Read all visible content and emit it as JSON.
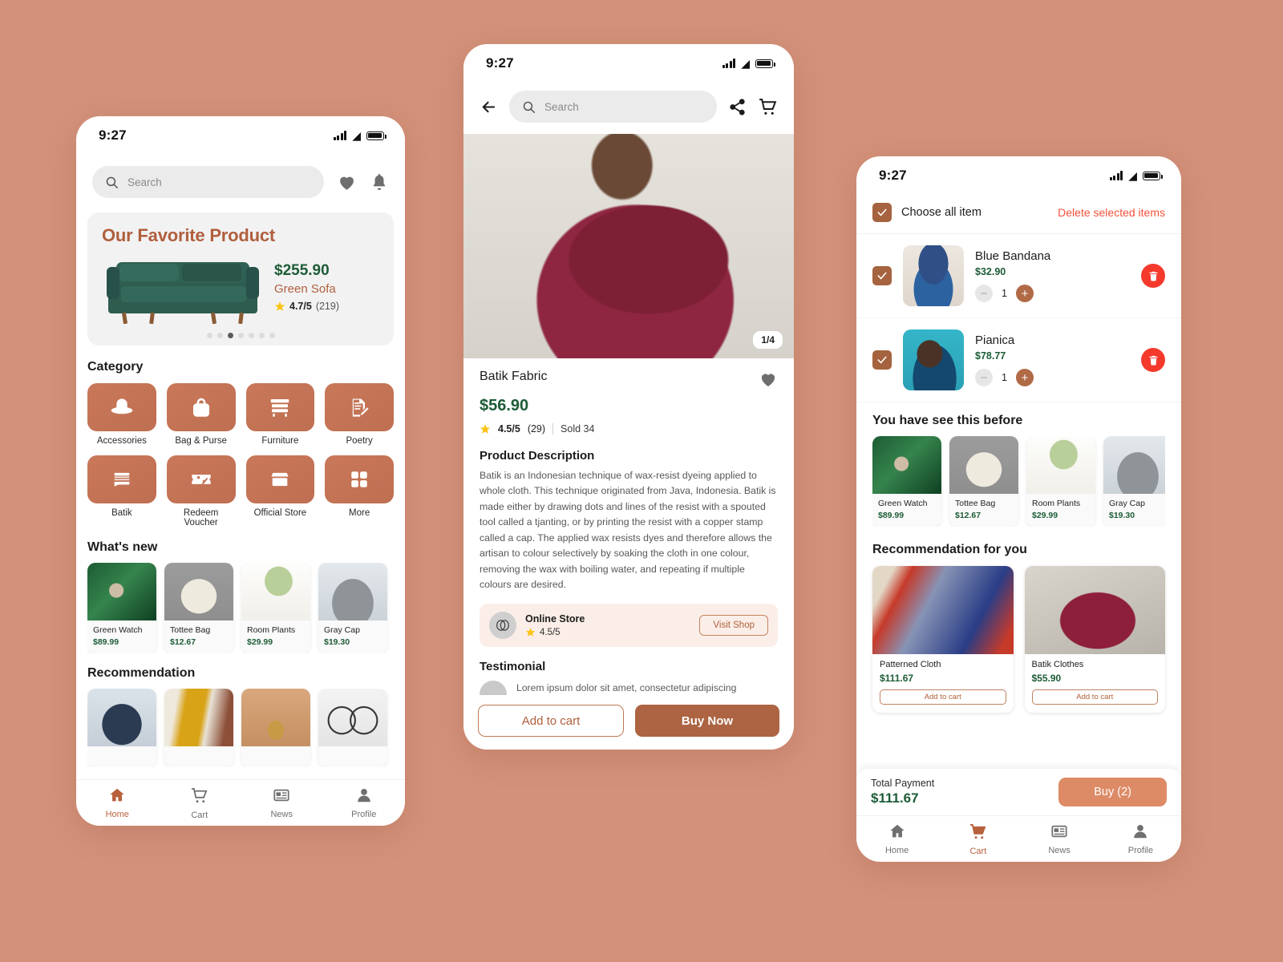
{
  "background_color": "#d4917a",
  "accent_color": "#b05f3d",
  "price_color": "#1d5c36",
  "danger_color": "#f53a2d",
  "status_bar": {
    "time": "9:27"
  },
  "phone1": {
    "search": {
      "placeholder": "Search",
      "icon": "search-icon"
    },
    "actions": [
      "heart-icon",
      "bell-icon"
    ],
    "hero": {
      "title": "Our Favorite Product",
      "price": "$255.90",
      "name": "Green Sofa",
      "rating": "4.7/5",
      "rating_count": "(219)",
      "dots_total": 7,
      "dots_active_index": 2
    },
    "category": {
      "title": "Category",
      "items": [
        {
          "label": "Accessories",
          "icon": "hat-icon"
        },
        {
          "label": "Bag & Purse",
          "icon": "handbag-icon"
        },
        {
          "label": "Furniture",
          "icon": "dresser-icon"
        },
        {
          "label": "Poetry",
          "icon": "document-pen-icon"
        },
        {
          "label": "Batik",
          "icon": "batik-icon"
        },
        {
          "label": "Redeem Voucher",
          "icon": "voucher-percent-icon"
        },
        {
          "label": "Official Store",
          "icon": "storefront-icon"
        },
        {
          "label": "More",
          "icon": "grid-icon"
        }
      ]
    },
    "whats_new": {
      "title": "What's  new",
      "items": [
        {
          "name": "Green Watch",
          "price": "$89.99",
          "image": "img-watch"
        },
        {
          "name": "Tottee Bag",
          "price": "$12.67",
          "image": "img-bag"
        },
        {
          "name": "Room Plants",
          "price": "$29.99",
          "image": "img-plant"
        },
        {
          "name": "Gray Cap",
          "price": "$19.30",
          "image": "img-cap"
        }
      ]
    },
    "recommendation": {
      "title": "Recommendation",
      "items": [
        {
          "image": "img-backpack"
        },
        {
          "image": "img-sweater"
        },
        {
          "image": "img-neck"
        },
        {
          "image": "img-glass"
        }
      ]
    },
    "bottom_nav": [
      {
        "label": "Home",
        "icon": "home-icon",
        "active": true
      },
      {
        "label": "Cart",
        "icon": "cart-icon",
        "active": false
      },
      {
        "label": "News",
        "icon": "news-icon",
        "active": false
      },
      {
        "label": "Profile",
        "icon": "profile-icon",
        "active": false
      }
    ]
  },
  "phone2": {
    "back_icon": "arrow-left-icon",
    "search": {
      "placeholder": "Search",
      "icon": "search-icon"
    },
    "actions": [
      "share-icon",
      "cart-icon"
    ],
    "gallery": {
      "counter": "1/4",
      "image": "img-batikhero"
    },
    "product": {
      "name": "Batik Fabric",
      "favorite_icon": "heart-icon",
      "price": "$56.90",
      "rating": "4.5/5",
      "rating_count": "(29)",
      "sold": "Sold 34"
    },
    "description": {
      "title": "Product Description",
      "body": "Batik is an Indonesian technique of wax-resist dyeing applied to whole cloth. This technique originated from Java, Indonesia. Batik is made either by drawing dots and lines of the resist with a spouted tool called a tjanting, or by printing the resist with a copper stamp called a cap. The applied wax resists dyes and therefore allows the artisan to colour selectively by soaking the cloth in one colour, removing the wax with boiling water, and repeating if multiple colours are desired."
    },
    "store": {
      "name": "Online Store",
      "rating": "4.5/5",
      "visit_label": "Visit Shop",
      "icon": "store-logo-icon"
    },
    "testimonial": {
      "title": "Testimonial",
      "text": "Lorem ipsum dolor sit amet, consectetur adipiscing"
    },
    "cta": {
      "add_to_cart": "Add to cart",
      "buy_now": "Buy Now"
    }
  },
  "phone3": {
    "header": {
      "choose_all": "Choose all item",
      "delete_selected": "Delete selected items",
      "checked": true
    },
    "cart_items": [
      {
        "name": "Blue Bandana",
        "price": "$32.90",
        "qty": "1",
        "checked": true,
        "image": "img-bandana",
        "delete_icon": "trash-icon"
      },
      {
        "name": "Pianica",
        "price": "$78.77",
        "qty": "1",
        "checked": true,
        "image": "img-pianica",
        "delete_icon": "trash-icon"
      }
    ],
    "seen_before": {
      "title": "You have see this before",
      "items": [
        {
          "name": "Green Watch",
          "price": "$89.99",
          "image": "img-watch"
        },
        {
          "name": "Tottee Bag",
          "price": "$12.67",
          "image": "img-bag"
        },
        {
          "name": "Room Plants",
          "price": "$29.99",
          "image": "img-plant"
        },
        {
          "name": "Gray Cap",
          "price": "$19.30",
          "image": "img-cap"
        }
      ]
    },
    "recommendation": {
      "title": "Recommendation for you",
      "items": [
        {
          "name": "Patterned Cloth",
          "price": "$111.67",
          "button": "Add to cart",
          "image": "img-cloth"
        },
        {
          "name": "Batik Clothes",
          "price": "$55.90",
          "button": "Add to cart",
          "image": "img-batikc"
        }
      ]
    },
    "total": {
      "label": "Total Payment",
      "value": "$111.67",
      "buy_label": "Buy (2)"
    },
    "bottom_nav": [
      {
        "label": "Home",
        "icon": "home-icon",
        "active": false
      },
      {
        "label": "Cart",
        "icon": "cart-icon",
        "active": true
      },
      {
        "label": "News",
        "icon": "news-icon",
        "active": false
      },
      {
        "label": "Profile",
        "icon": "profile-icon",
        "active": false
      }
    ]
  }
}
